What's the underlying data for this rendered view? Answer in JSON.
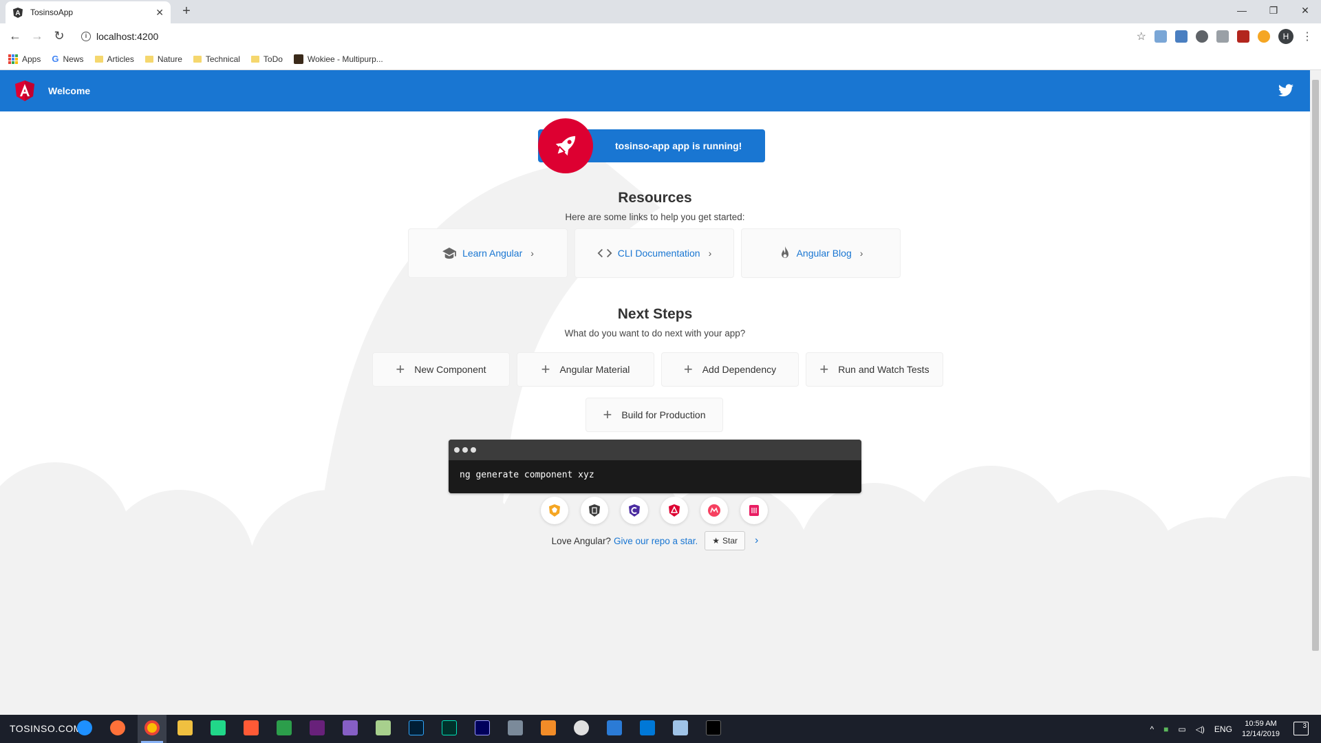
{
  "browser": {
    "tab_title": "TosinsoApp",
    "url": "localhost:4200",
    "profile_initial": "H",
    "bookmarks": [
      {
        "label": "Apps",
        "icon": "apps-grid-icon"
      },
      {
        "label": "News",
        "icon": "google-icon"
      },
      {
        "label": "Articles",
        "icon": "folder-icon"
      },
      {
        "label": "Nature",
        "icon": "folder-icon"
      },
      {
        "label": "Technical",
        "icon": "folder-icon"
      },
      {
        "label": "ToDo",
        "icon": "folder-icon"
      },
      {
        "label": "Wokiee - Multipurp...",
        "icon": "site-favicon-icon"
      }
    ]
  },
  "toolbar": {
    "title": "Welcome"
  },
  "banner": {
    "text": "tosinso-app app is running!"
  },
  "resources": {
    "title": "Resources",
    "subtitle": "Here are some links to help you get started:",
    "links": [
      {
        "label": "Learn Angular",
        "icon": "school-icon"
      },
      {
        "label": "CLI Documentation",
        "icon": "code-icon"
      },
      {
        "label": "Angular Blog",
        "icon": "flame-icon"
      }
    ]
  },
  "next_steps": {
    "title": "Next Steps",
    "subtitle": "What do you want to do next with your app?",
    "buttons": [
      "New Component",
      "Angular Material",
      "Add Dependency",
      "Run and Watch Tests",
      "Build for Production"
    ]
  },
  "terminal": {
    "command": "ng generate component xyz"
  },
  "footer": {
    "love_text": "Love Angular?",
    "link_text": "Give our repo a star.",
    "star_label": "Star"
  },
  "taskbar": {
    "watermark": "TOSINSO.COM",
    "language": "ENG",
    "time": "10:59 AM",
    "date": "12/14/2019",
    "notification_count": "3"
  },
  "colors": {
    "angular_red": "#dd0031",
    "toolbar_blue": "#1976d2",
    "cloud_gray": "#f2f2f2"
  }
}
